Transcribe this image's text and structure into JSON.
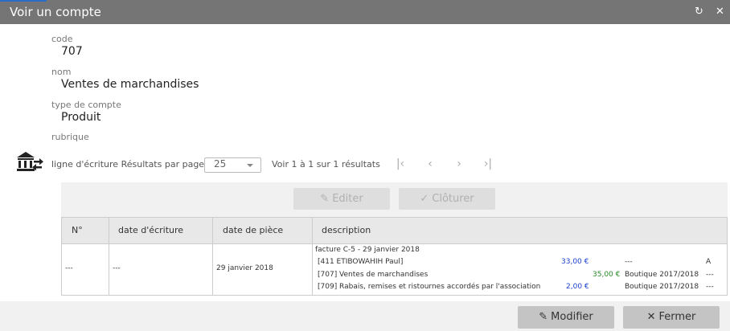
{
  "window": {
    "title": "Voir un compte",
    "refresh_icon": "refresh-icon",
    "close_icon": "close-icon"
  },
  "fields": [
    {
      "label": "code",
      "value": "707"
    },
    {
      "label": "nom",
      "value": "Ventes de marchandises"
    },
    {
      "label": "type de compte",
      "value": "Produit"
    },
    {
      "label": "rubrique",
      "value": ""
    }
  ],
  "grid": {
    "icon": "bank-transfer-icon",
    "caption": "ligne d'écriture",
    "per_page_label": "Résultats par page",
    "per_page_value": "25",
    "pager_info": "Voir 1 à 1 sur 1 résultats",
    "pager_icons": [
      "first-page-icon",
      "prev-page-icon",
      "next-page-icon",
      "last-page-icon"
    ],
    "toolbar": {
      "edit_label": "Editer",
      "close_label": "Clôturer"
    },
    "columns": [
      "N°",
      "date d'écriture",
      "date de pièce",
      "description"
    ],
    "row": {
      "num": "---",
      "date_ecriture": "---",
      "date_piece": "29 janvier 2018",
      "description": "facture C-5 - 29 janvier 2018",
      "lines": [
        {
          "account": "[411 ETIBOWAHIH Paul]",
          "debit": "33,00 €",
          "credit": "",
          "project": "---",
          "flag": "A"
        },
        {
          "account": "[707] Ventes de marchandises",
          "debit": "",
          "credit": "35,00 €",
          "project": "Boutique 2017/2018",
          "flag": "---"
        },
        {
          "account": "[709] Rabais, remises et ristournes accordés par l'association",
          "debit": "2,00 €",
          "credit": "",
          "project": "Boutique 2017/2018",
          "flag": "---"
        }
      ]
    }
  },
  "footer": {
    "modify_label": "Modifier",
    "close_label": "Fermer"
  },
  "colors": {
    "titlebar": "#757575",
    "debit": "#1a3fd0",
    "credit": "#2a8a2a"
  }
}
